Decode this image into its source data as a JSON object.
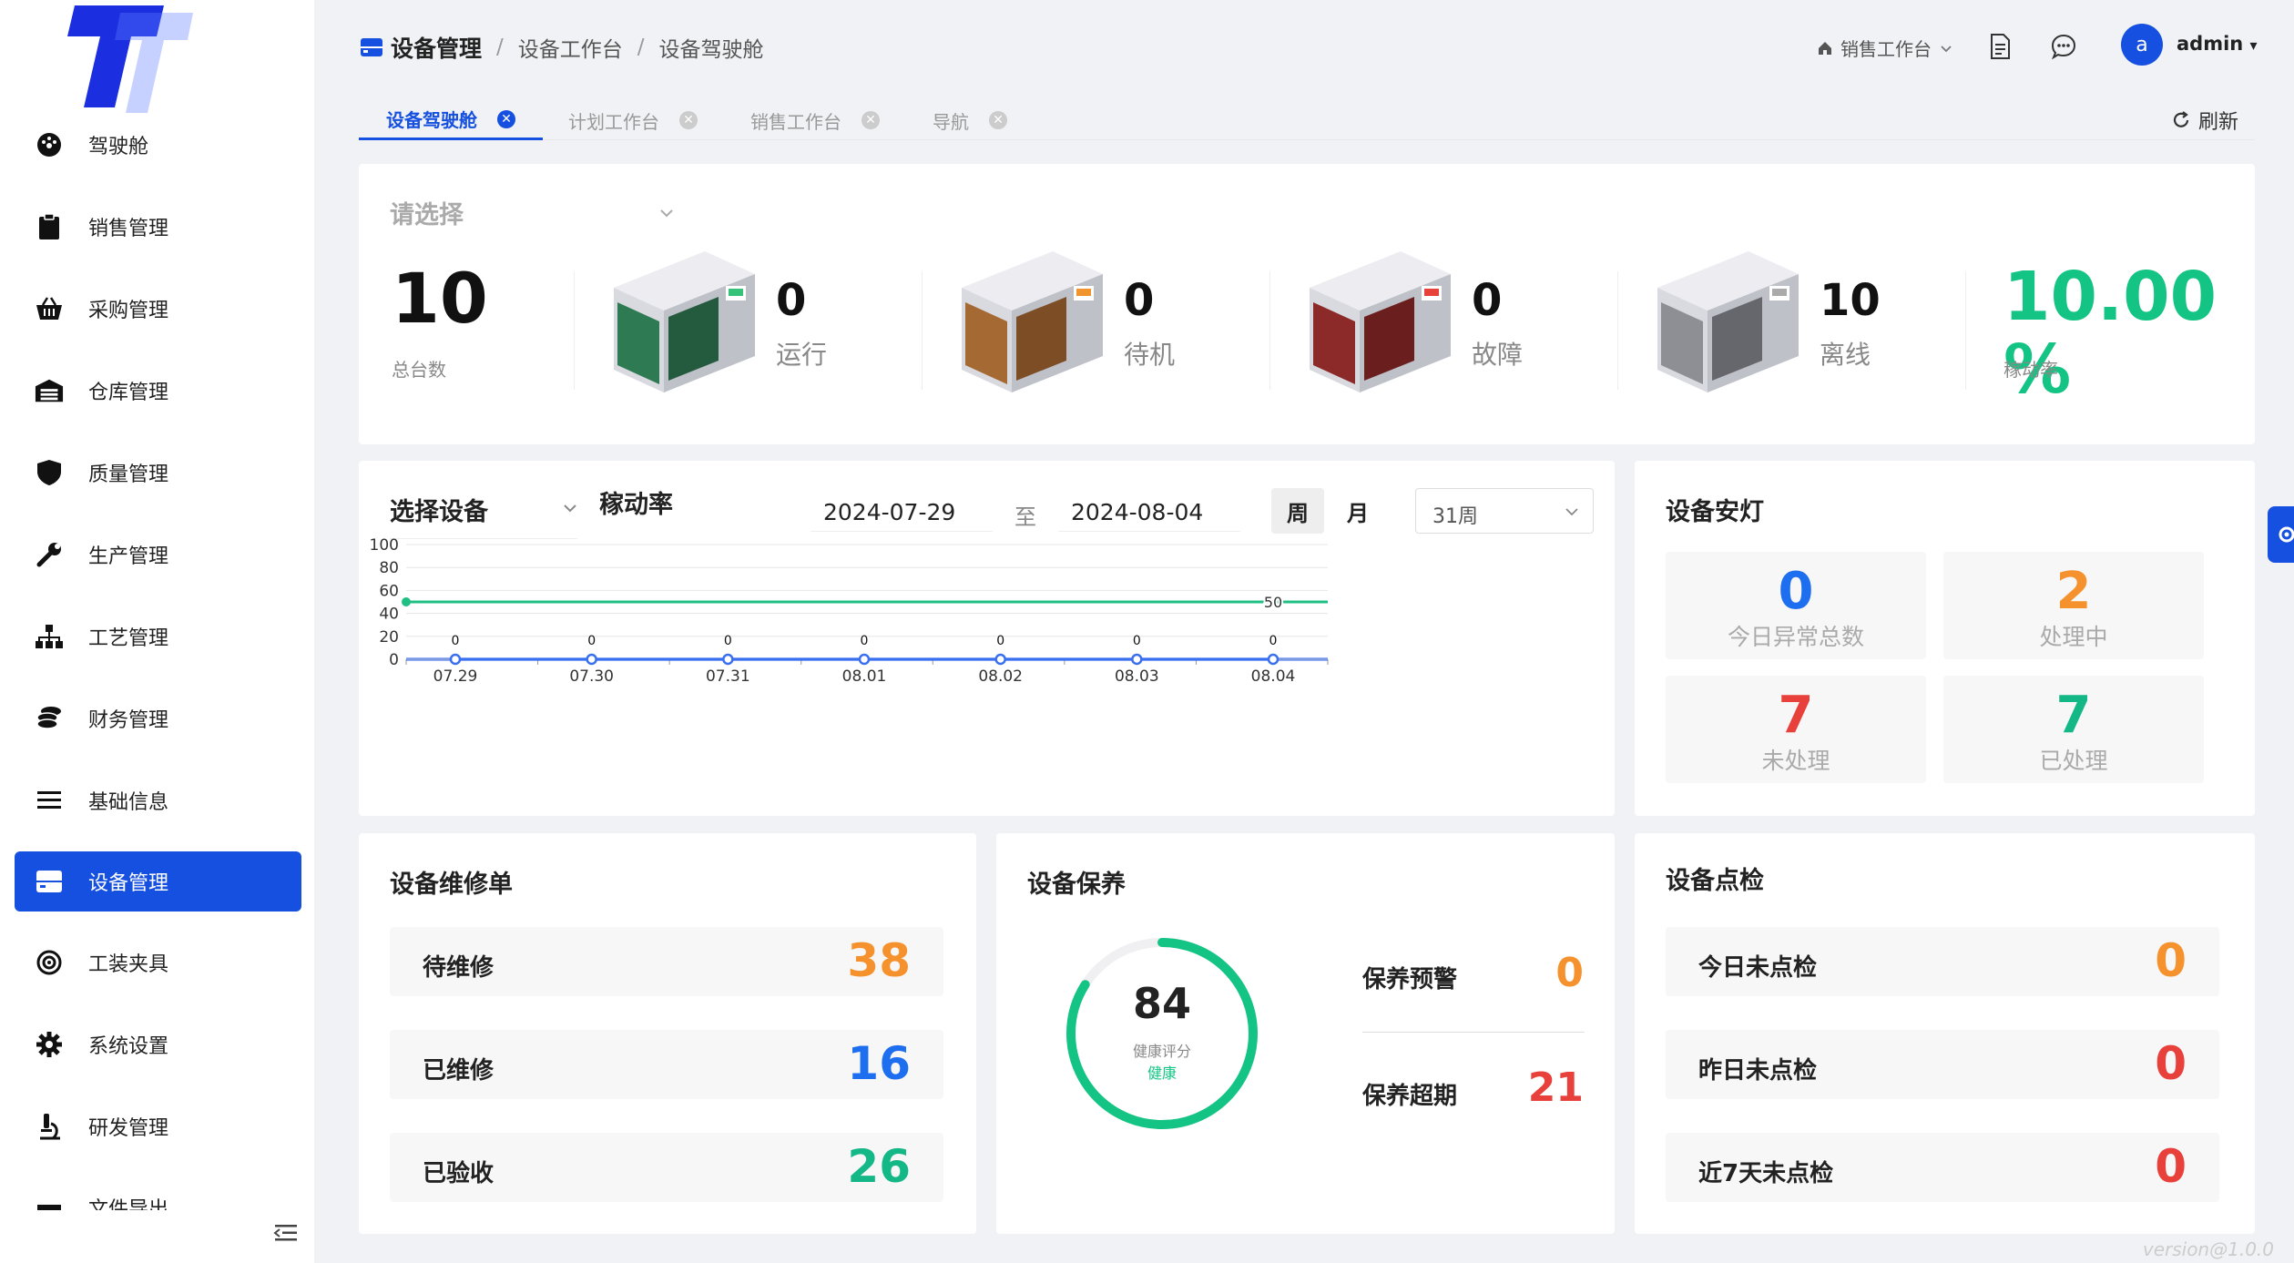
{
  "sidebar": {
    "items": [
      {
        "label": "驾驶舱",
        "icon": "dashboard-icon"
      },
      {
        "label": "销售管理",
        "icon": "clipboard-icon"
      },
      {
        "label": "采购管理",
        "icon": "basket-icon"
      },
      {
        "label": "仓库管理",
        "icon": "warehouse-icon"
      },
      {
        "label": "质量管理",
        "icon": "shield-icon"
      },
      {
        "label": "生产管理",
        "icon": "wrench-icon"
      },
      {
        "label": "工艺管理",
        "icon": "sitemap-icon"
      },
      {
        "label": "财务管理",
        "icon": "coins-icon"
      },
      {
        "label": "基础信息",
        "icon": "menu-icon"
      },
      {
        "label": "设备管理",
        "icon": "device-icon",
        "active": true
      },
      {
        "label": "工装夹具",
        "icon": "target-icon"
      },
      {
        "label": "系统设置",
        "icon": "gear-icon"
      },
      {
        "label": "研发管理",
        "icon": "microscope-icon"
      },
      {
        "label": "文件导出",
        "icon": "export-icon"
      }
    ]
  },
  "header": {
    "breadcrumb": [
      "设备管理",
      "设备工作台",
      "设备驾驶舱"
    ],
    "workspace": "销售工作台",
    "user": "admin",
    "avatar_letter": "a"
  },
  "tabs": [
    {
      "label": "设备驾驶舱",
      "active": true
    },
    {
      "label": "计划工作台"
    },
    {
      "label": "销售工作台"
    },
    {
      "label": "导航"
    }
  ],
  "refresh_label": "刷新",
  "overview": {
    "select_placeholder": "请选择",
    "total": {
      "value": "10",
      "label": "总台数"
    },
    "running": {
      "value": "0",
      "label": "运行"
    },
    "standby": {
      "value": "0",
      "label": "待机"
    },
    "fault": {
      "value": "0",
      "label": "故障"
    },
    "offline": {
      "value": "10",
      "label": "离线"
    },
    "utilization": {
      "value": "10.00 %",
      "label": "稼动率"
    }
  },
  "chart_panel": {
    "select_label": "选择设备",
    "title": "稼动率",
    "start_date": "2024-07-29",
    "to": "至",
    "end_date": "2024-08-04",
    "week": "周",
    "month": "月",
    "week_select": "31周"
  },
  "chart_data": {
    "type": "line",
    "categories": [
      "07.29",
      "07.30",
      "07.31",
      "08.01",
      "08.02",
      "08.03",
      "08.04"
    ],
    "ylim": [
      0,
      100
    ],
    "yticks": [
      "100",
      "80",
      "60",
      "40",
      "20",
      "0"
    ],
    "series": [
      {
        "values": [
          0,
          0,
          0,
          0,
          0,
          0,
          0
        ],
        "color": "#3a6ff0"
      }
    ],
    "reference_line": {
      "value": 50,
      "label": "50",
      "color": "#1fbf84"
    }
  },
  "andon": {
    "title": "设备安灯",
    "tiles": [
      {
        "value": "0",
        "label": "今日异常总数",
        "color": "#1e6ef0"
      },
      {
        "value": "2",
        "label": "处理中",
        "color": "#f5922d"
      },
      {
        "value": "7",
        "label": "未处理",
        "color": "#e8403a"
      },
      {
        "value": "7",
        "label": "已处理",
        "color": "#14b886"
      }
    ]
  },
  "repair": {
    "title": "设备维修单",
    "rows": [
      {
        "label": "待维修",
        "value": "38",
        "color": "#f5922d"
      },
      {
        "label": "已维修",
        "value": "16",
        "color": "#1e6ef0"
      },
      {
        "label": "已验收",
        "value": "26",
        "color": "#14b886"
      }
    ]
  },
  "maintenance": {
    "title": "设备保养",
    "score": "84",
    "score_label": "健康评分",
    "status": "健康",
    "score_fraction": 0.84,
    "warning_label": "保养预警",
    "warning_value": "0",
    "overdue_label": "保养超期",
    "overdue_value": "21"
  },
  "inspection": {
    "title": "设备点检",
    "rows": [
      {
        "label": "今日未点检",
        "value": "0",
        "color": "#f5922d"
      },
      {
        "label": "昨日未点检",
        "value": "0",
        "color": "#e8403a"
      },
      {
        "label": "近7天未点检",
        "value": "0",
        "color": "#e8403a"
      }
    ]
  },
  "version": "version@1.0.0"
}
